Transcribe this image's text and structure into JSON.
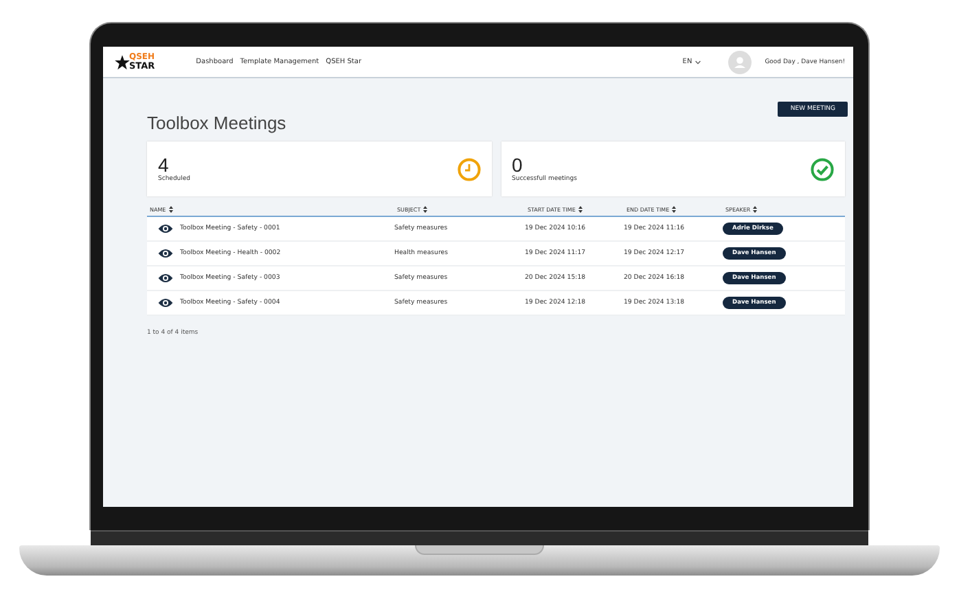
{
  "app": {
    "logo": {
      "line1": "QSEH",
      "line2": "STAR"
    },
    "nav": [
      {
        "label": "Dashboard"
      },
      {
        "label": "Template Management"
      },
      {
        "label": "QSEH Star"
      }
    ],
    "language": "EN",
    "greeting": "Good Day , Dave Hansen!"
  },
  "page": {
    "title": "Toolbox Meetings",
    "new_button": "NEW MEETING"
  },
  "stats": [
    {
      "kind": "clock",
      "value": "4",
      "label": "Scheduled",
      "color": "#f0a30a"
    },
    {
      "kind": "check",
      "value": "0",
      "label": "Successfull meetings",
      "color": "#28a745"
    }
  ],
  "table": {
    "columns": [
      "NAME",
      "SUBJECT",
      "START DATE TIME",
      "END DATE TIME",
      "SPEAKER"
    ],
    "rows": [
      {
        "name": "Toolbox Meeting - Safety - 0001",
        "subject": "Safety measures",
        "start": "19 Dec 2024 10:16",
        "end": "19 Dec 2024 11:16",
        "speaker": "Adrie Dirkse"
      },
      {
        "name": "Toolbox Meeting - Health - 0002",
        "subject": "Health measures",
        "start": "19 Dec 2024 11:17",
        "end": "19 Dec 2024 12:17",
        "speaker": "Dave Hansen"
      },
      {
        "name": "Toolbox Meeting - Safety - 0003",
        "subject": "Safety measures",
        "start": "20 Dec 2024 15:18",
        "end": "20 Dec 2024 16:18",
        "speaker": "Dave Hansen"
      },
      {
        "name": "Toolbox Meeting - Safety - 0004",
        "subject": "Safety measures",
        "start": "19 Dec 2024 12:18",
        "end": "19 Dec 2024 13:18",
        "speaker": "Dave Hansen"
      }
    ]
  },
  "pager": "1 to 4 of 4 items"
}
